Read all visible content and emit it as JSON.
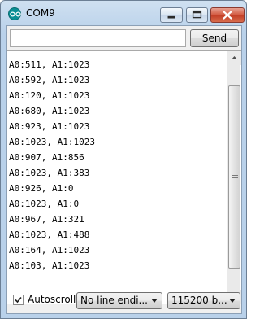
{
  "window": {
    "title": "COM9"
  },
  "toolbar": {
    "input_value": "",
    "send_label": "Send"
  },
  "output": {
    "lines": [
      "A0:511, A1:1023",
      "A0:592, A1:1023",
      "A0:120, A1:1023",
      "A0:680, A1:1023",
      "A0:923, A1:1023",
      "A0:1023, A1:1023",
      "A0:907, A1:856",
      "A0:1023, A1:383",
      "A0:926, A1:0",
      "A0:1023, A1:0",
      "A0:967, A1:321",
      "A0:1023, A1:488",
      "A0:164, A1:1023",
      "A0:103, A1:1023"
    ]
  },
  "footer": {
    "autoscroll_label": "Autoscroll",
    "autoscroll_checked": true,
    "line_ending": "No line endi...",
    "baud_rate": "115200 b..."
  },
  "icons": {
    "app": "arduino-logo-icon",
    "minimize": "minimize-icon",
    "maximize": "maximize-icon",
    "close": "close-icon",
    "check": "checkmark-icon",
    "dropdown": "chevron-down-icon",
    "scroll_up": "arrow-up-icon",
    "scroll_down": "arrow-down-icon"
  },
  "colors": {
    "accent": "#0b8f95",
    "close": "#c23c24"
  }
}
